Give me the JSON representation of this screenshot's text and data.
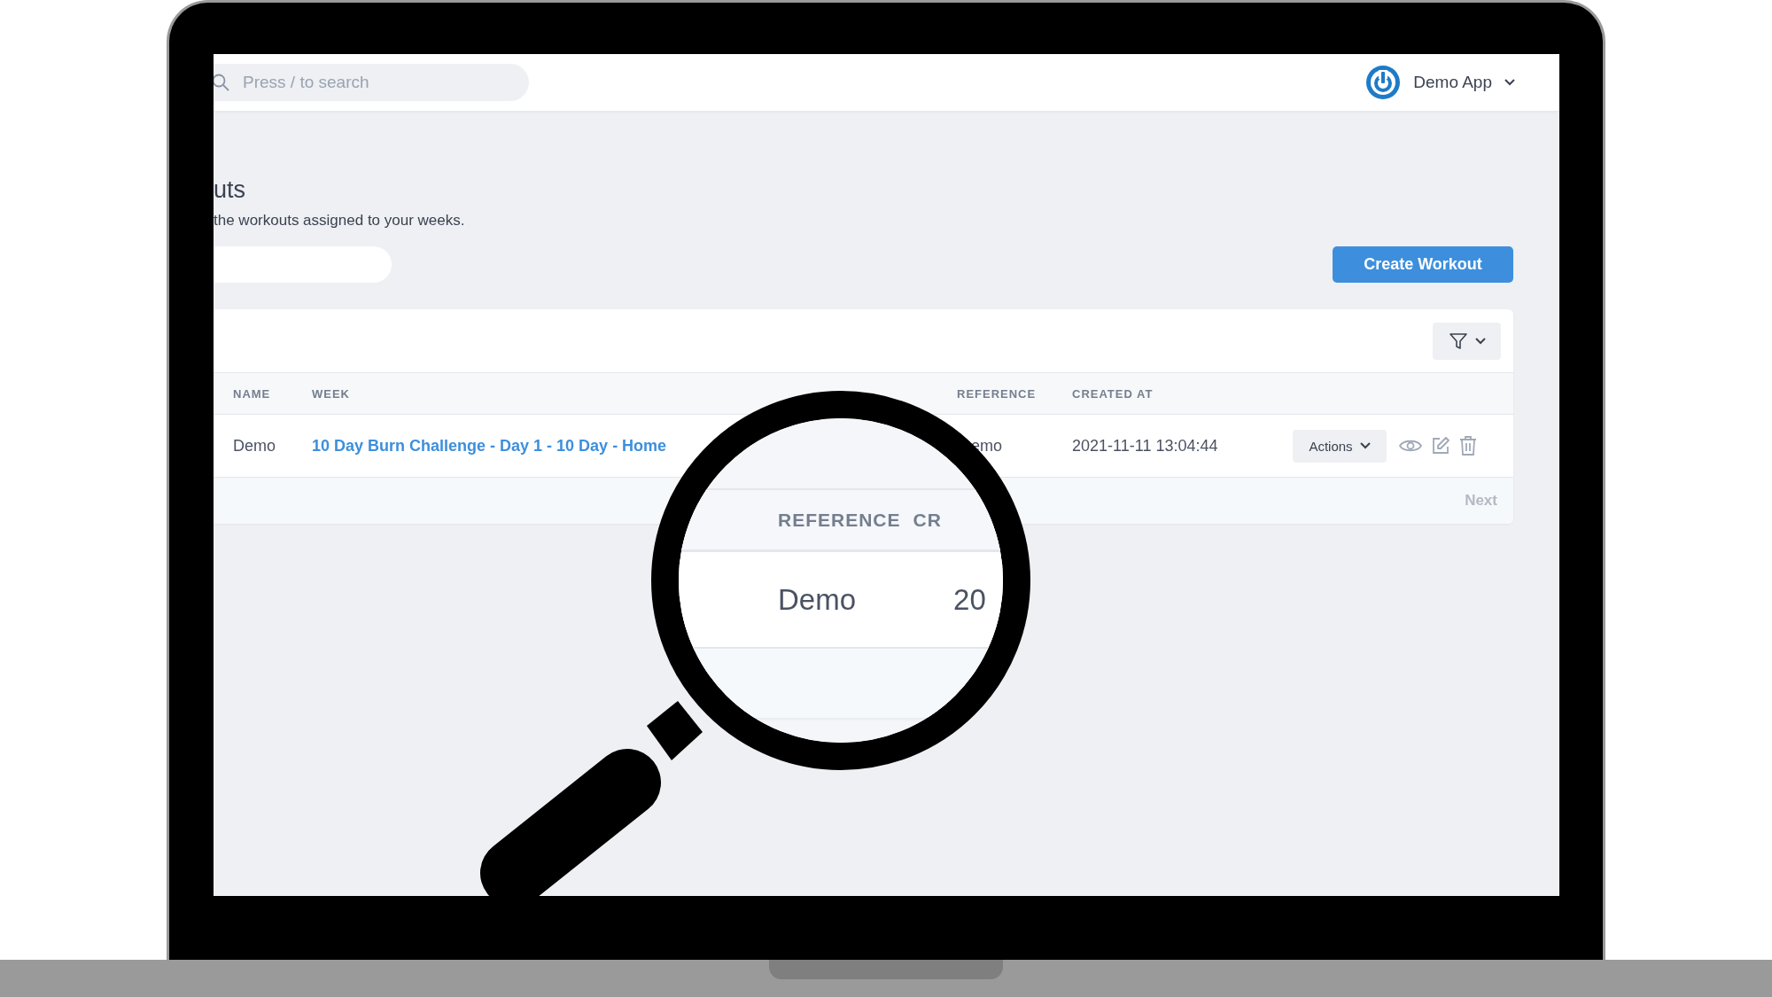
{
  "topbar": {
    "search": {
      "placeholder": "Press / to search"
    },
    "account": {
      "label": "Demo App"
    }
  },
  "page": {
    "title": "uts",
    "subtitle": "the workouts assigned to your weeks.",
    "create_button": "Create Workout"
  },
  "table": {
    "columns": [
      "NAME",
      "WEEK",
      "REFERENCE",
      "CREATED AT"
    ],
    "rows": [
      {
        "name": "Demo",
        "week": "10 Day Burn Challenge - Day 1 - 10 Day - Home",
        "reference": "emo",
        "created_at": "2021-11-11 13:04:44",
        "actions": "Actions"
      }
    ],
    "pager": {
      "next": "Next",
      "disabled": true
    }
  },
  "magnifier": {
    "columns": [
      "REFERENCE",
      "CR"
    ],
    "cells": [
      "Demo",
      "20"
    ]
  }
}
